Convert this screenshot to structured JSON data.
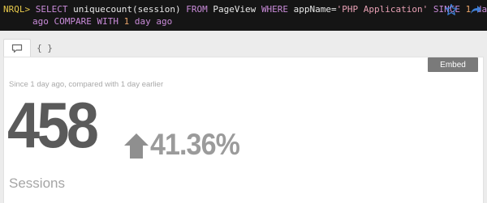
{
  "query_bar": {
    "prompt": "NRQL>",
    "line1": [
      {
        "t": " SELECT ",
        "c": "kw"
      },
      {
        "t": "uniquecount",
        "c": "plain"
      },
      {
        "t": "(session) ",
        "c": "plain"
      },
      {
        "t": "FROM",
        "c": "kw"
      },
      {
        "t": " PageView ",
        "c": "plain"
      },
      {
        "t": "WHERE",
        "c": "kw"
      },
      {
        "t": " appName=",
        "c": "plain"
      },
      {
        "t": "'PHP Application'",
        "c": "str"
      },
      {
        "t": " SINCE ",
        "c": "kw"
      },
      {
        "t": "1",
        "c": "num"
      },
      {
        "t": " day",
        "c": "kw"
      }
    ],
    "line2": [
      {
        "t": "ago",
        "c": "kw"
      },
      {
        "t": " COMPARE ",
        "c": "kw"
      },
      {
        "t": "WITH",
        "c": "kw"
      },
      {
        "t": " 1",
        "c": "num"
      },
      {
        "t": " day ago",
        "c": "kw"
      }
    ],
    "star_icon": "star-icon",
    "share_icon": "share-icon"
  },
  "tabs": {
    "chart_tab_icon": "chart-bubble-icon",
    "json_tab_label": "{ }"
  },
  "panel": {
    "embed_label": "Embed",
    "subtitle": "Since 1 day ago, compared with 1 day earlier",
    "value": "458",
    "change": "41.36%",
    "change_direction": "up",
    "metric_label": "Sessions"
  },
  "colors": {
    "query_bg": "#151515",
    "keyword": "#c98bd9",
    "string": "#e7a0b4",
    "number": "#e9a46a",
    "icon_blue": "#3f7fd6"
  }
}
